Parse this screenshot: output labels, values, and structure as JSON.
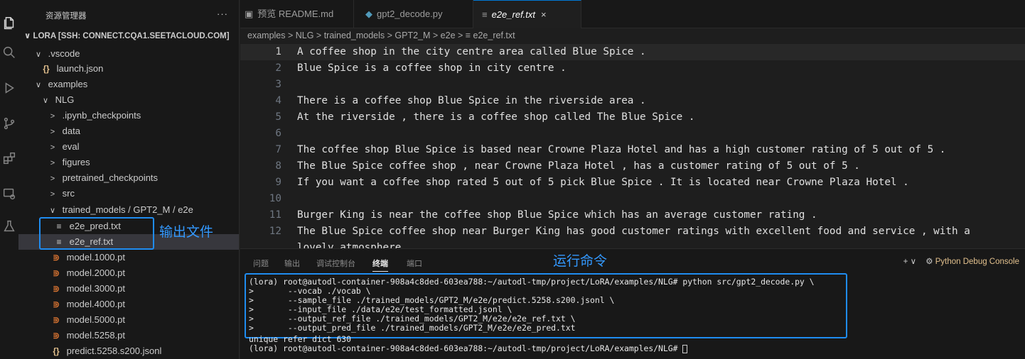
{
  "sidebar": {
    "title": "资源管理器",
    "more": "···",
    "root": "LORA [SSH: CONNECT.CQA1.SEETACLOUD.COM]",
    "items": [
      {
        "chev": "∨",
        "icon": "",
        "label": ".vscode"
      },
      {
        "chev": "",
        "icon": "{}",
        "label": "launch.json"
      },
      {
        "chev": "∨",
        "icon": "",
        "label": "examples"
      },
      {
        "chev": "∨",
        "icon": "",
        "label": "NLG"
      },
      {
        "chev": ">",
        "icon": "",
        "label": ".ipynb_checkpoints"
      },
      {
        "chev": ">",
        "icon": "",
        "label": "data"
      },
      {
        "chev": ">",
        "icon": "",
        "label": "eval"
      },
      {
        "chev": ">",
        "icon": "",
        "label": "figures"
      },
      {
        "chev": ">",
        "icon": "",
        "label": "pretrained_checkpoints"
      },
      {
        "chev": ">",
        "icon": "",
        "label": "src"
      },
      {
        "chev": "∨",
        "icon": "",
        "label": "trained_models / GPT2_M / e2e"
      },
      {
        "chev": "",
        "icon": "≡",
        "label": "e2e_pred.txt"
      },
      {
        "chev": "",
        "icon": "≡",
        "label": "e2e_ref.txt"
      },
      {
        "chev": "",
        "icon": "⋑",
        "label": "model.1000.pt"
      },
      {
        "chev": "",
        "icon": "⋑",
        "label": "model.2000.pt"
      },
      {
        "chev": "",
        "icon": "⋑",
        "label": "model.3000.pt"
      },
      {
        "chev": "",
        "icon": "⋑",
        "label": "model.4000.pt"
      },
      {
        "chev": "",
        "icon": "⋑",
        "label": "model.5000.pt"
      },
      {
        "chev": "",
        "icon": "⋑",
        "label": "model.5258.pt"
      },
      {
        "chev": "",
        "icon": "{}",
        "label": "predict.5258.s200.jsonl"
      }
    ]
  },
  "annotations": {
    "output_files": "输出文件",
    "run_command": "运行命令",
    "color": "#1f8cf0"
  },
  "tabs": [
    {
      "icon": "▣",
      "label": "预览 README.md"
    },
    {
      "icon": "◆",
      "label": "gpt2_decode.py"
    },
    {
      "icon": "≡",
      "label": "e2e_ref.txt",
      "close": "×"
    }
  ],
  "breadcrumb": "examples > NLG > trained_models > GPT2_M > e2e > ≡ e2e_ref.txt",
  "editor": {
    "lines": [
      {
        "n": "1",
        "text": "A coffee shop in the city centre area called Blue Spice ."
      },
      {
        "n": "2",
        "text": "Blue Spice is a coffee shop in city centre ."
      },
      {
        "n": "3",
        "text": ""
      },
      {
        "n": "4",
        "text": "There is a coffee shop Blue Spice in the riverside area ."
      },
      {
        "n": "5",
        "text": "At the riverside , there is a coffee shop called The Blue Spice ."
      },
      {
        "n": "6",
        "text": ""
      },
      {
        "n": "7",
        "text": "The coffee shop Blue Spice is based near Crowne Plaza Hotel and has a high customer rating of 5 out of 5 ."
      },
      {
        "n": "8",
        "text": "The Blue Spice coffee shop , near Crowne Plaza Hotel , has a customer rating of 5 out of 5 ."
      },
      {
        "n": "9",
        "text": "If you want a coffee shop rated 5 out of 5 pick Blue Spice . It is located near Crowne Plaza Hotel ."
      },
      {
        "n": "10",
        "text": ""
      },
      {
        "n": "11",
        "text": "Burger King is near the coffee shop Blue Spice which has an average customer rating ."
      },
      {
        "n": "12",
        "text": "The Blue Spice coffee shop near Burger King has good customer ratings with excellent food and service , with a"
      },
      {
        "n": "",
        "text": "lovely atmosphere ."
      }
    ]
  },
  "panel": {
    "tabs": [
      "问题",
      "输出",
      "调试控制台",
      "终端",
      "端口"
    ],
    "active_tab": "终端",
    "right_icons": "+ ∨",
    "debug_label": "Python Debug Console",
    "terminal": [
      "(lora) root@autodl-container-908a4c8ded-603ea788:~/autodl-tmp/project/LoRA/examples/NLG# python src/gpt2_decode.py \\",
      ">       --vocab ./vocab \\",
      ">       --sample_file ./trained_models/GPT2_M/e2e/predict.5258.s200.jsonl \\",
      ">       --input_file ./data/e2e/test_formatted.jsonl \\",
      ">       --output_ref_file ./trained_models/GPT2_M/e2e/e2e_ref.txt \\",
      ">       --output_pred_file ./trained_models/GPT2_M/e2e/e2e_pred.txt",
      "unique refer dict 630",
      "(lora) root@autodl-container-908a4c8ded-603ea788:~/autodl-tmp/project/LoRA/examples/NLG# "
    ]
  }
}
